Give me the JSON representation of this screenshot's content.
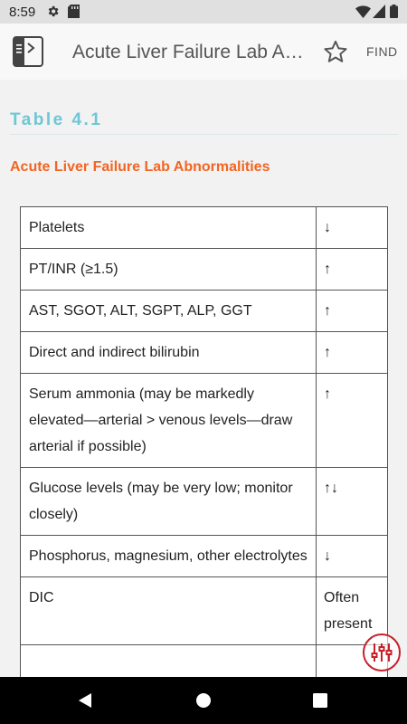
{
  "status_bar": {
    "time": "8:59",
    "icons": [
      "gear-icon",
      "sd-card-icon",
      "wifi-icon",
      "cellular-signal-icon",
      "battery-icon"
    ]
  },
  "app_bar": {
    "title": "Acute Liver Failure Lab Abnormalities",
    "find_label": "FIND",
    "icons": [
      "book-toc-icon",
      "star-icon"
    ]
  },
  "content": {
    "table_label": "Table 4.1",
    "table_caption": "Acute Liver Failure Lab Abnormalities",
    "rows": [
      {
        "parameter": "Platelets",
        "change": "↓"
      },
      {
        "parameter": "PT/INR (≥1.5)",
        "change": "↑"
      },
      {
        "parameter": "AST, SGOT, ALT, SGPT, ALP, GGT",
        "change": "↑"
      },
      {
        "parameter": "Direct and indirect bilirubin",
        "change": "↑"
      },
      {
        "parameter": "Serum ammonia (may be markedly elevated—arterial > venous levels—draw arterial if possible)",
        "change": "↑"
      },
      {
        "parameter": "Glucose levels (may be very low; monitor closely)",
        "change": "↑↓"
      },
      {
        "parameter": "Phosphorus, magnesium, other electrolytes",
        "change": "↓"
      },
      {
        "parameter": "DIC",
        "change": "Often present"
      }
    ]
  },
  "floating_button": {
    "icon": "sliders-settings-icon",
    "color": "#c8202a"
  },
  "nav_bar": {
    "icons": [
      "back-icon",
      "home-icon",
      "recents-icon"
    ]
  },
  "colors": {
    "accent_label": "#6ec6d6",
    "caption": "#f26522",
    "status_bar": "#e0e0e0"
  }
}
